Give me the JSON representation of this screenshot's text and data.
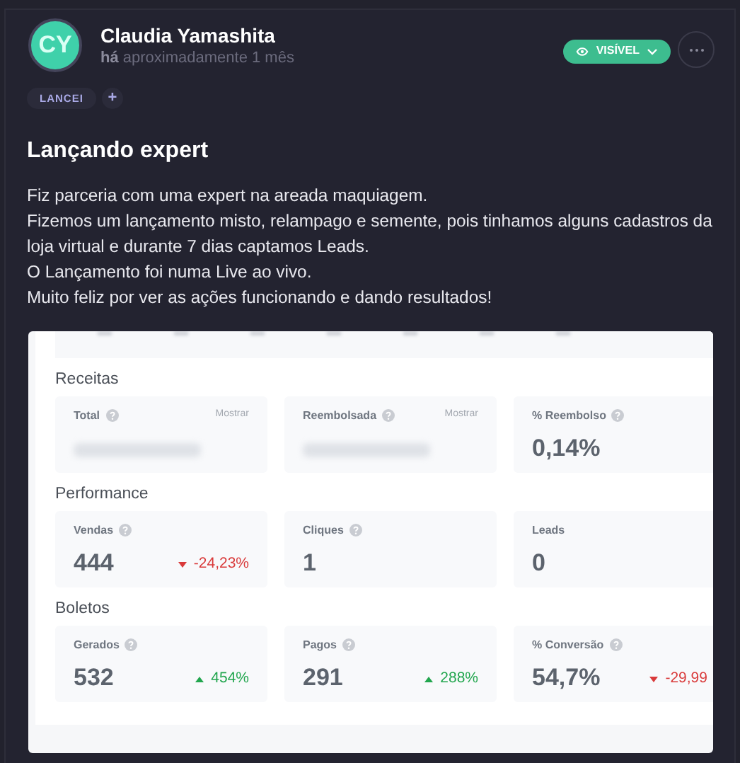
{
  "post": {
    "author": {
      "initials": "CY",
      "name": "Claudia Yamashita",
      "time_prefix": "há",
      "time": "aproximadamente 1 mês"
    },
    "visibility": {
      "label": "VISÍVEL"
    },
    "tags": [
      {
        "label": "LANCEI"
      }
    ],
    "add_tag": "+",
    "title": "Lançando expert",
    "body": [
      "Fiz parceria com uma expert na areada maquiagem.",
      "Fizemos um lançamento misto, relampago e semente, pois tinhamos alguns cadastros da loja virtual e durante 7 dias captamos Leads.",
      "O Lançamento foi numa Live ao vivo.",
      "Muito feliz por ver as ações funcionando e dando resultados!"
    ],
    "dashboard": {
      "sections": [
        {
          "title": "Receitas",
          "metrics": [
            {
              "label": "Total",
              "help": true,
              "toggle": "Mostrar",
              "hidden": true
            },
            {
              "label": "Reembolsada",
              "help": true,
              "toggle": "Mostrar",
              "hidden": true
            },
            {
              "label": "% Reembolso",
              "help": true,
              "hidden": false,
              "value": "0,14%"
            }
          ]
        },
        {
          "title": "Performance",
          "metrics": [
            {
              "label": "Vendas",
              "help": true,
              "hidden": false,
              "value": "444",
              "change": {
                "text": "-24,23%",
                "kind": "down"
              }
            },
            {
              "label": "Cliques",
              "help": true,
              "hidden": false,
              "value": "1"
            },
            {
              "label": "Leads",
              "help": false,
              "hidden": false,
              "value": "0"
            }
          ]
        },
        {
          "title": "Boletos",
          "metrics": [
            {
              "label": "Gerados",
              "help": true,
              "hidden": false,
              "value": "532",
              "change": {
                "text": "454%",
                "kind": "up"
              }
            },
            {
              "label": "Pagos",
              "help": true,
              "hidden": false,
              "value": "291",
              "change": {
                "text": "288%",
                "kind": "up"
              }
            },
            {
              "label": "% Conversão",
              "help": true,
              "hidden": false,
              "value": "54,7%",
              "change": {
                "text": "-29,99",
                "kind": "down"
              }
            }
          ]
        }
      ]
    }
  }
}
